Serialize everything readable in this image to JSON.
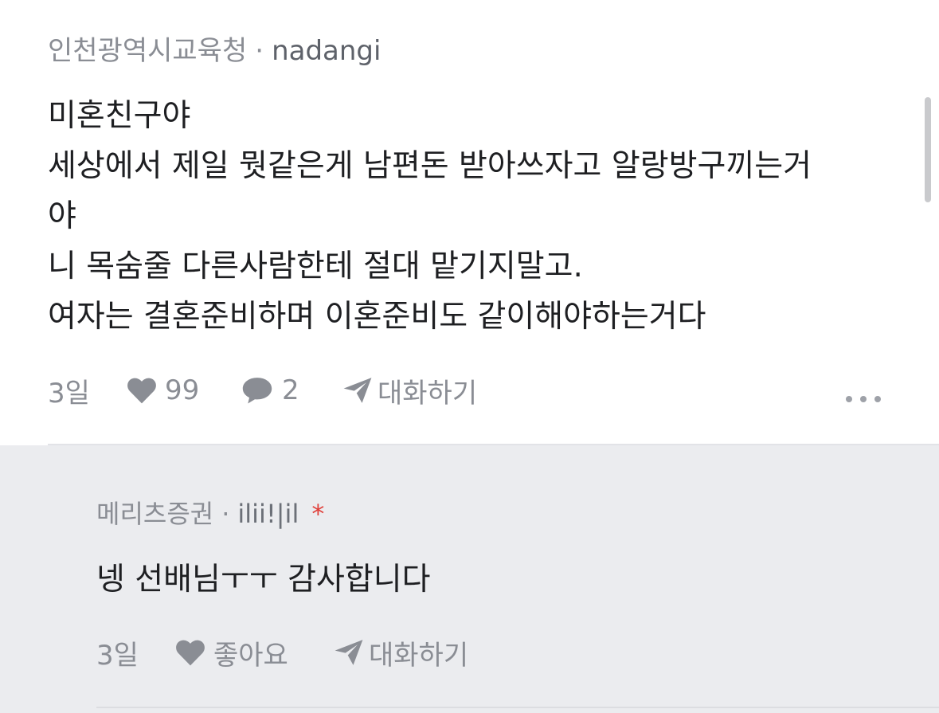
{
  "comment": {
    "affiliation": "인천광역시교육청",
    "separator": "·",
    "nickname": "nadangi",
    "lines": [
      "미혼친구야",
      "세상에서 제일 뭣같은게 남편돈 받아쓰자고 알랑방구끼는거",
      "야",
      "니 목숨줄 다른사람한테 절대 맡기지말고.",
      "여자는 결혼준비하며 이혼준비도 같이해야하는거다"
    ],
    "time": "3일",
    "like_count": "99",
    "reply_count": "2",
    "chat_label": "대화하기",
    "icons": [
      "heart-icon",
      "speech-bubble-icon",
      "paper-plane-icon",
      "more-dots-icon"
    ]
  },
  "reply": {
    "affiliation": "메리츠증권",
    "separator": "·",
    "nickname": "ilii!|il",
    "op_marker": "*",
    "text": "넹 선배님ㅜㅜ 감사합니다",
    "time": "3일",
    "like_label": "좋아요",
    "chat_label": "대화하기",
    "icons": [
      "heart-icon",
      "paper-plane-icon"
    ]
  },
  "colors": {
    "meta_gray": "#8a8d94",
    "body_text": "#1e1f22",
    "reply_background": "#ebecef",
    "op_marker_red": "#e0403a"
  }
}
